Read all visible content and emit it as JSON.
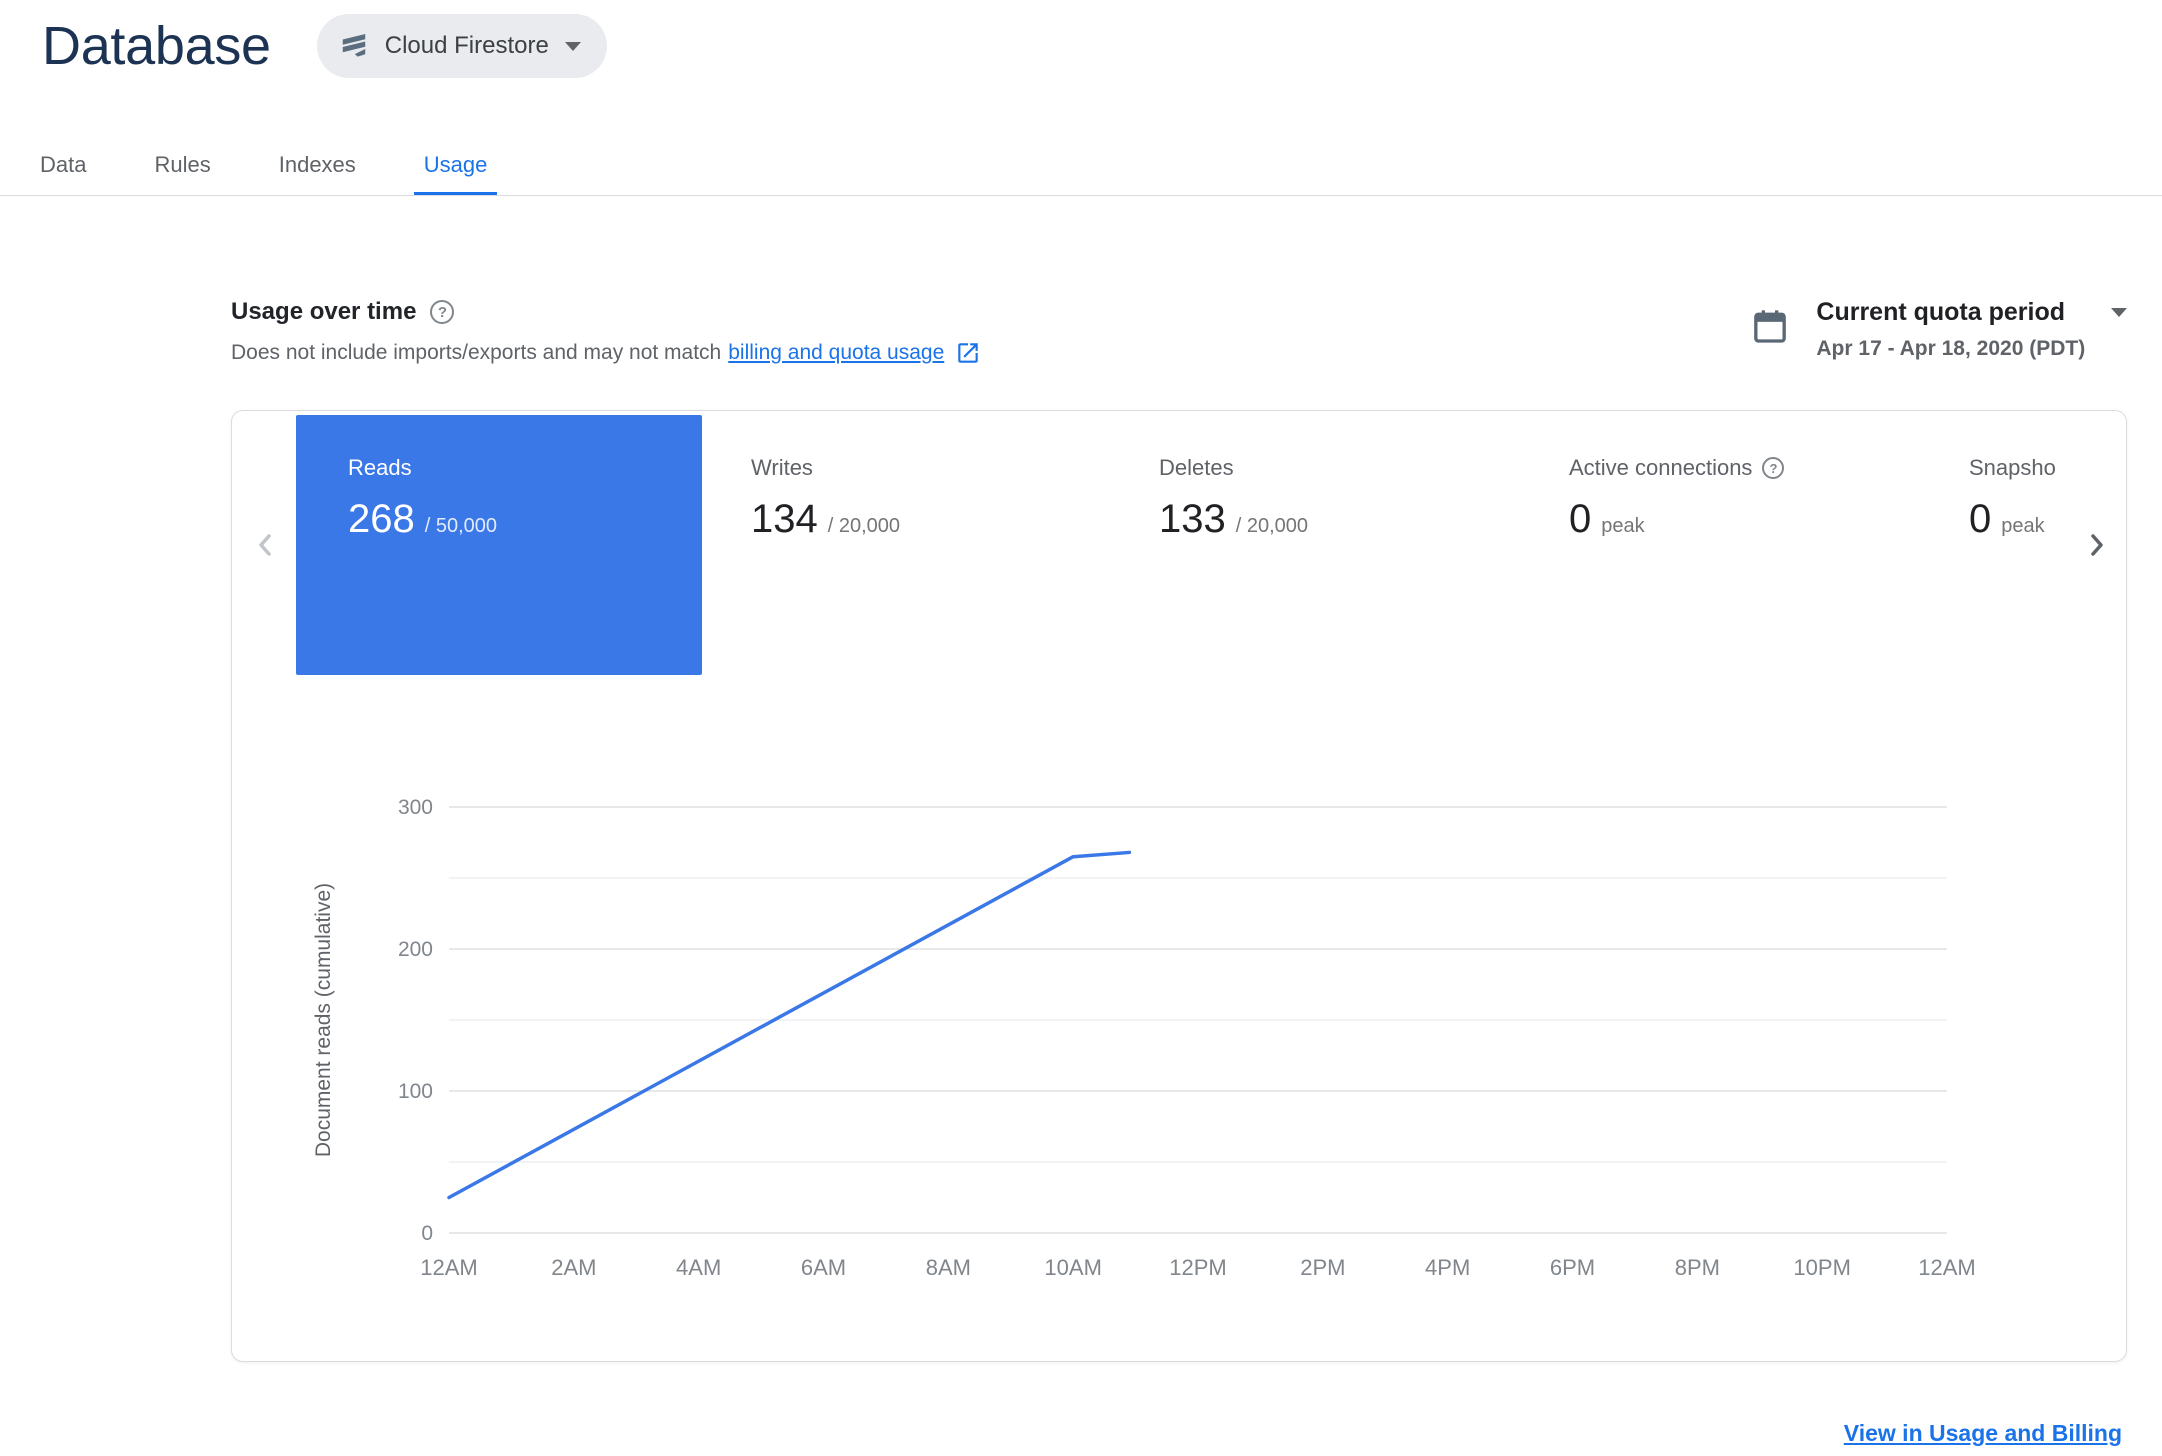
{
  "page": {
    "title": "Database",
    "footer_link": "View in Usage and Billing"
  },
  "product_selector": {
    "label": "Cloud Firestore"
  },
  "tabs": [
    {
      "label": "Data"
    },
    {
      "label": "Rules"
    },
    {
      "label": "Indexes"
    },
    {
      "label": "Usage"
    }
  ],
  "active_tab": "Usage",
  "usage_header": {
    "title": "Usage over time",
    "description": "Does not include imports/exports and may not match",
    "link_text": "billing and quota usage"
  },
  "quota_period": {
    "label": "Current quota period",
    "range": "Apr 17 - Apr 18, 2020 (PDT)"
  },
  "metrics": [
    {
      "label": "Reads",
      "value": "268",
      "quota": "/ 50,000",
      "selected": true
    },
    {
      "label": "Writes",
      "value": "134",
      "quota": "/ 20,000",
      "selected": false
    },
    {
      "label": "Deletes",
      "value": "133",
      "quota": "/ 20,000",
      "selected": false
    },
    {
      "label": "Active connections",
      "value": "0",
      "quota": "peak",
      "selected": false,
      "has_help_icon": true
    },
    {
      "label": "Snapsho",
      "value": "0",
      "quota": "peak",
      "selected": false,
      "truncated": true
    }
  ],
  "colors": {
    "accent": "#1a73e8",
    "selected_tile": "#3b78e7",
    "chart_line": "#3b78e7"
  },
  "chart_data": {
    "type": "line",
    "title": "",
    "xlabel": "",
    "ylabel": "Document reads (cumulative)",
    "x_ticks": [
      "12AM",
      "2AM",
      "4AM",
      "6AM",
      "8AM",
      "10AM",
      "12PM",
      "2PM",
      "4PM",
      "6PM",
      "8PM",
      "10PM",
      "12AM"
    ],
    "x_range_hours": [
      0,
      24
    ],
    "ylim": [
      0,
      300
    ],
    "y_tick_labels": [
      0,
      100,
      200,
      300
    ],
    "gridline_interval": 50,
    "grid": "horizontal-only",
    "legend": "none",
    "series": [
      {
        "name": "Document reads (cumulative)",
        "color": "#3b78e7",
        "points": [
          {
            "hour": 0,
            "value": 25
          },
          {
            "hour": 10,
            "value": 265
          },
          {
            "hour": 10.9,
            "value": 268
          }
        ]
      }
    ]
  }
}
